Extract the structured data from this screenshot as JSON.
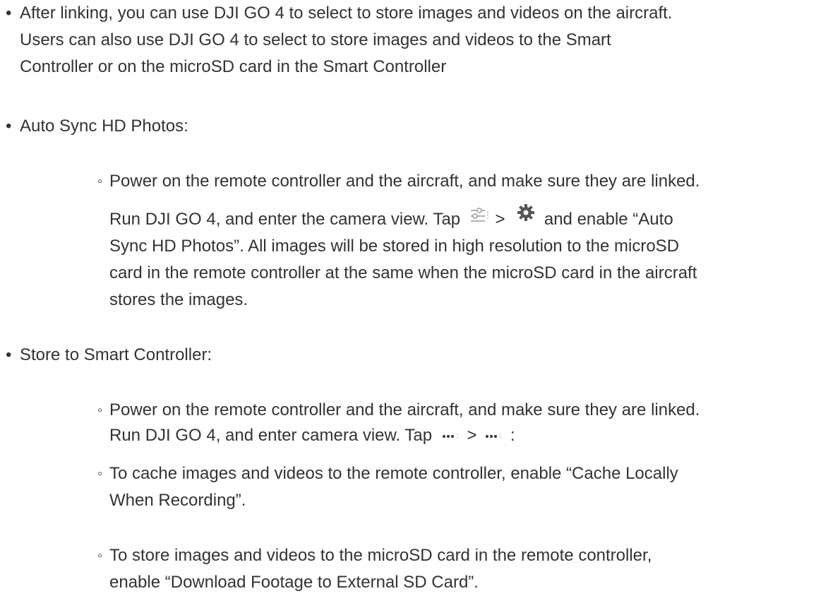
{
  "bullets": {
    "linking": {
      "line1": "After linking, you can use DJI GO 4 to select to store images and videos on the aircraft.",
      "line2": "Users can also use DJI GO 4 to select to store images and videos to the Smart",
      "line3": "Controller or on the microSD card in the Smart Controller"
    },
    "auto_sync": {
      "heading": "Auto Sync HD Photos:",
      "step1": "Power on the remote controller and the aircraft, and make sure they are linked.",
      "run_before": "Run DJI GO 4, and enter the camera view. Tap",
      "sep": ">",
      "run_after": "and enable “Auto",
      "line3": "Sync HD Photos”. All images will be stored in high resolution to the microSD",
      "line4": "card in the remote controller at the same when the microSD card in the aircraft",
      "line5": "stores the images."
    },
    "store": {
      "heading": "Store to Smart Controller:",
      "step1": "Power on the remote controller and the aircraft, and make sure they are linked.",
      "run_before": "Run DJI GO 4, and enter camera view. Tap",
      "sep": ">",
      "run_after": ":",
      "cache_line1": "To cache images and videos to the remote controller, enable “Cache Locally",
      "cache_line2": "When Recording”.",
      "sd_line1": "To store images and videos to the microSD card in the remote controller,",
      "sd_line2": "enable “Download Footage to External SD Card”."
    }
  },
  "symbols": {
    "bullet": "•",
    "sub_bullet": "◦"
  },
  "icons": {
    "camera_settings": "sliders-icon",
    "gear": "gear-icon",
    "more": "more-dots-icon"
  },
  "colors": {
    "text": "#333333",
    "icon": "#555555"
  }
}
